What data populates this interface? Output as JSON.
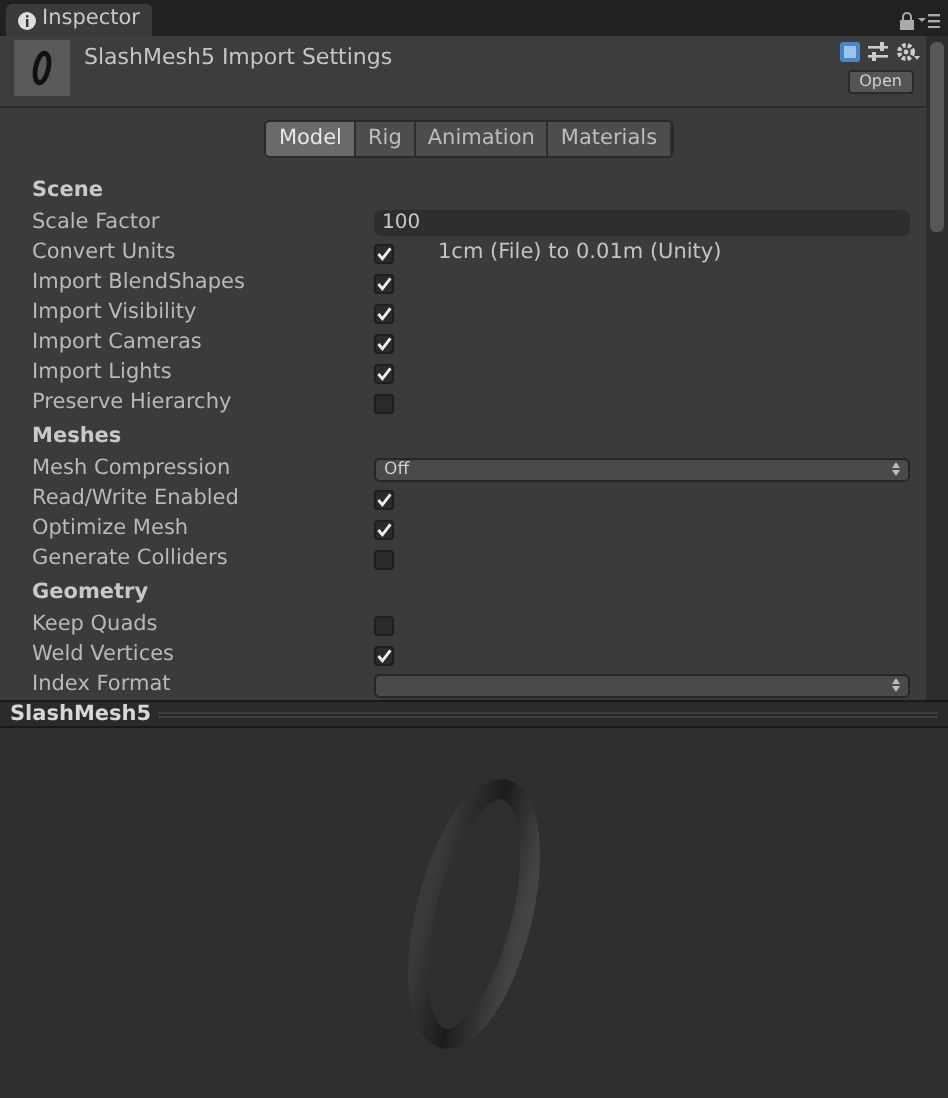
{
  "panel_tab": {
    "title": "Inspector"
  },
  "header": {
    "title": "SlashMesh5 Import Settings",
    "open_button": "Open"
  },
  "tabs": [
    {
      "label": "Model",
      "selected": true
    },
    {
      "label": "Rig",
      "selected": false
    },
    {
      "label": "Animation",
      "selected": false
    },
    {
      "label": "Materials",
      "selected": false
    }
  ],
  "sections": [
    {
      "title": "Scene",
      "rows": [
        {
          "kind": "text",
          "label": "Scale Factor",
          "value": "100"
        },
        {
          "kind": "checkbox",
          "label": "Convert Units",
          "checked": true,
          "note": "1cm (File) to 0.01m (Unity)"
        },
        {
          "kind": "checkbox",
          "label": "Import BlendShapes",
          "checked": true
        },
        {
          "kind": "checkbox",
          "label": "Import Visibility",
          "checked": true
        },
        {
          "kind": "checkbox",
          "label": "Import Cameras",
          "checked": true
        },
        {
          "kind": "checkbox",
          "label": "Import Lights",
          "checked": true
        },
        {
          "kind": "checkbox",
          "label": "Preserve Hierarchy",
          "checked": false
        }
      ]
    },
    {
      "title": "Meshes",
      "rows": [
        {
          "kind": "dropdown",
          "label": "Mesh Compression",
          "value": "Off"
        },
        {
          "kind": "checkbox",
          "label": "Read/Write Enabled",
          "checked": true
        },
        {
          "kind": "checkbox",
          "label": "Optimize Mesh",
          "checked": true
        },
        {
          "kind": "checkbox",
          "label": "Generate Colliders",
          "checked": false
        }
      ]
    },
    {
      "title": "Geometry",
      "rows": [
        {
          "kind": "checkbox",
          "label": "Keep Quads",
          "checked": false
        },
        {
          "kind": "checkbox",
          "label": "Weld Vertices",
          "checked": true
        },
        {
          "kind": "dropdown",
          "label": "Index Format"
        }
      ]
    }
  ],
  "preview": {
    "title": "SlashMesh5"
  }
}
